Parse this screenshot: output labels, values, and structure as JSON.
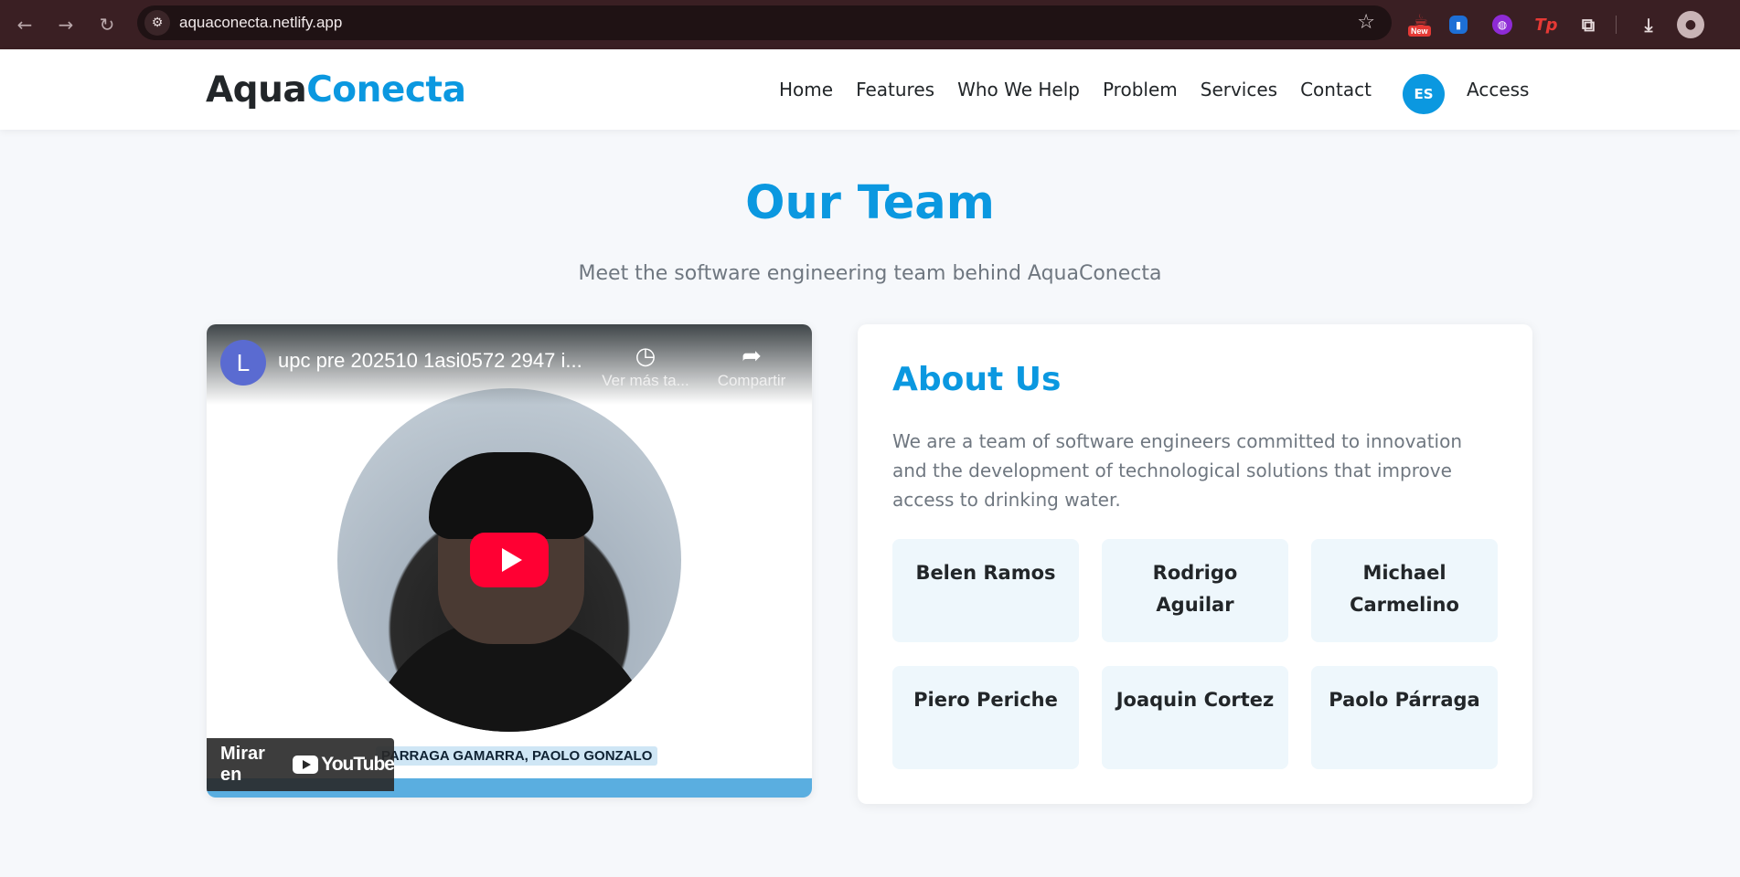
{
  "browser": {
    "url": "aquaconecta.netlify.app",
    "back_icon": "arrow-left-icon",
    "forward_icon": "arrow-right-icon",
    "reload_icon": "reload-icon",
    "bookmark_icon": "star-icon",
    "extension_new_badge": "New",
    "extension_tp_label": "Tp"
  },
  "header": {
    "logo_part1": "Aqua",
    "logo_part2": "Conecta",
    "nav": [
      "Home",
      "Features",
      "Who We Help",
      "Problem",
      "Services",
      "Contact"
    ],
    "language_button": "ES",
    "access_link": "Access"
  },
  "section": {
    "title": "Our Team",
    "subtitle": "Meet the software engineering team behind AquaConecta"
  },
  "video": {
    "channel_initial": "L",
    "title": "upc pre 202510 1asi0572 2947 i...",
    "watch_later_label": "Ver más ta...",
    "share_label": "Compartir",
    "caption": "PARRAGA GAMARRA, PAOLO GONZALO",
    "watch_on_label": "Mirar en",
    "youtube_label": "YouTube"
  },
  "about": {
    "title": "About Us",
    "description": "We are a team of software engineers committed to innovation and the development of technological solutions that improve access to drinking water.",
    "members": [
      "Belen Ramos",
      "Rodrigo Aguilar",
      "Michael Carmelino",
      "Piero Periche",
      "Joaquin Cortez",
      "Paolo Párraga"
    ]
  },
  "colors": {
    "brand": "#0b98e0",
    "dark_text": "#222629",
    "muted_text": "#6f7780",
    "member_card_bg": "#eef7fc",
    "browser_frame": "#3a1f23"
  }
}
